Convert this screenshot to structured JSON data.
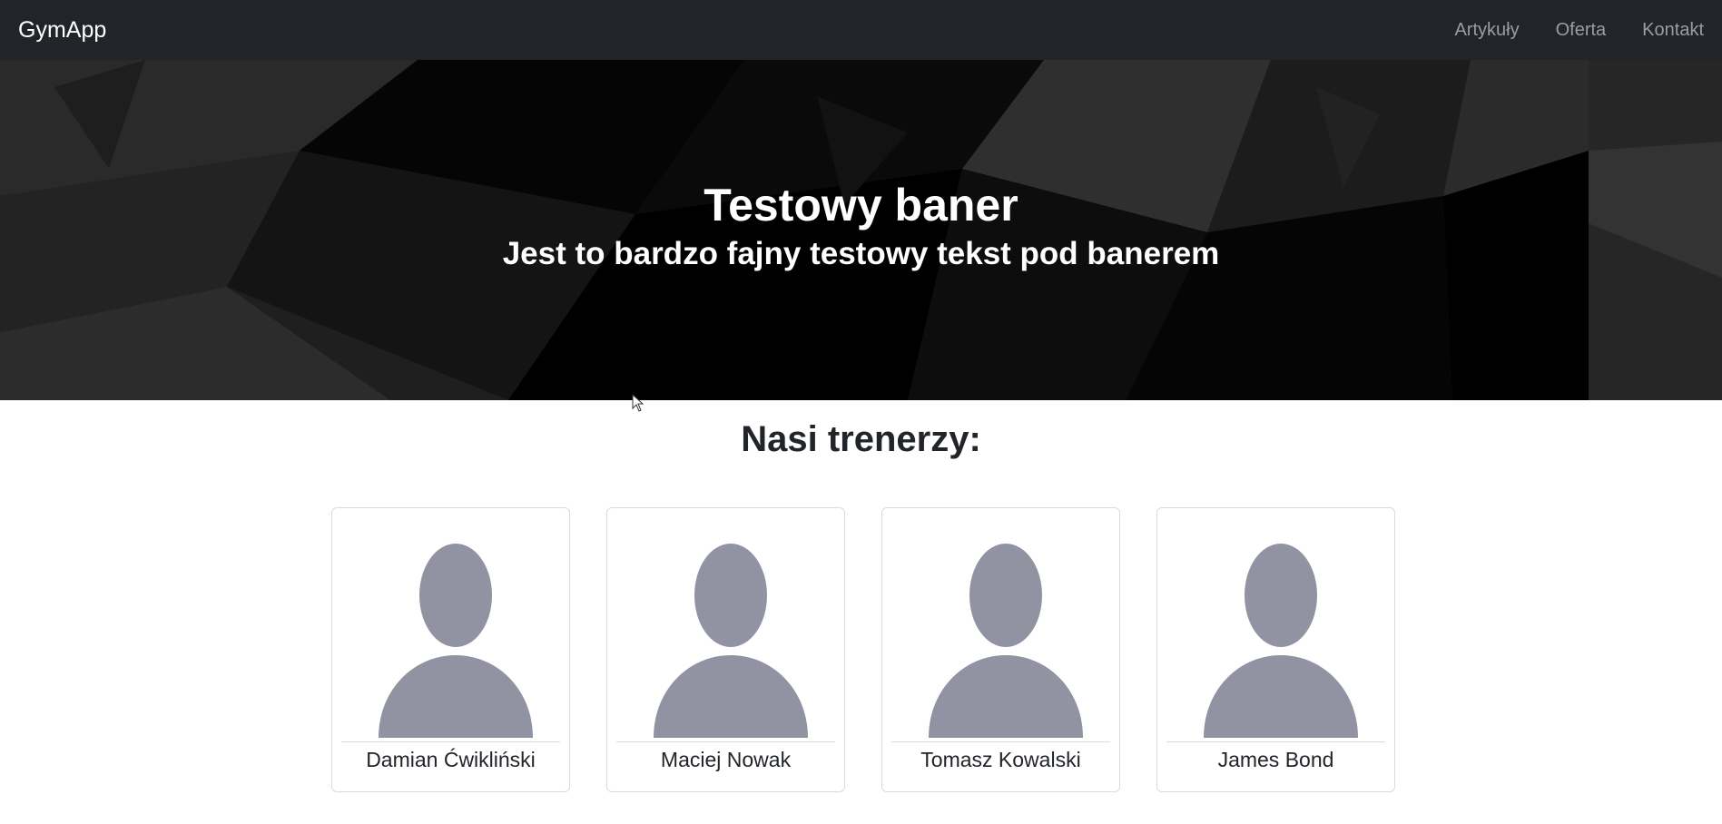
{
  "navbar": {
    "brand": "GymApp",
    "links": [
      {
        "label": "Artykuły"
      },
      {
        "label": "Oferta"
      },
      {
        "label": "Kontakt"
      }
    ]
  },
  "banner": {
    "title": "Testowy baner",
    "subtitle": "Jest to bardzo fajny testowy tekst pod banerem"
  },
  "trainers": {
    "heading": "Nasi trenerzy:",
    "items": [
      {
        "name": "Damian Ćwikliński",
        "avatar_icon": "person-placeholder-icon"
      },
      {
        "name": "Maciej Nowak",
        "avatar_icon": "person-placeholder-icon"
      },
      {
        "name": "Tomasz Kowalski",
        "avatar_icon": "person-placeholder-icon"
      },
      {
        "name": "James Bond",
        "avatar_icon": "person-placeholder-icon"
      }
    ]
  },
  "colors": {
    "navbar_bg": "#212529",
    "banner_bg": "#141414",
    "avatar_fill": "#9293a2"
  }
}
